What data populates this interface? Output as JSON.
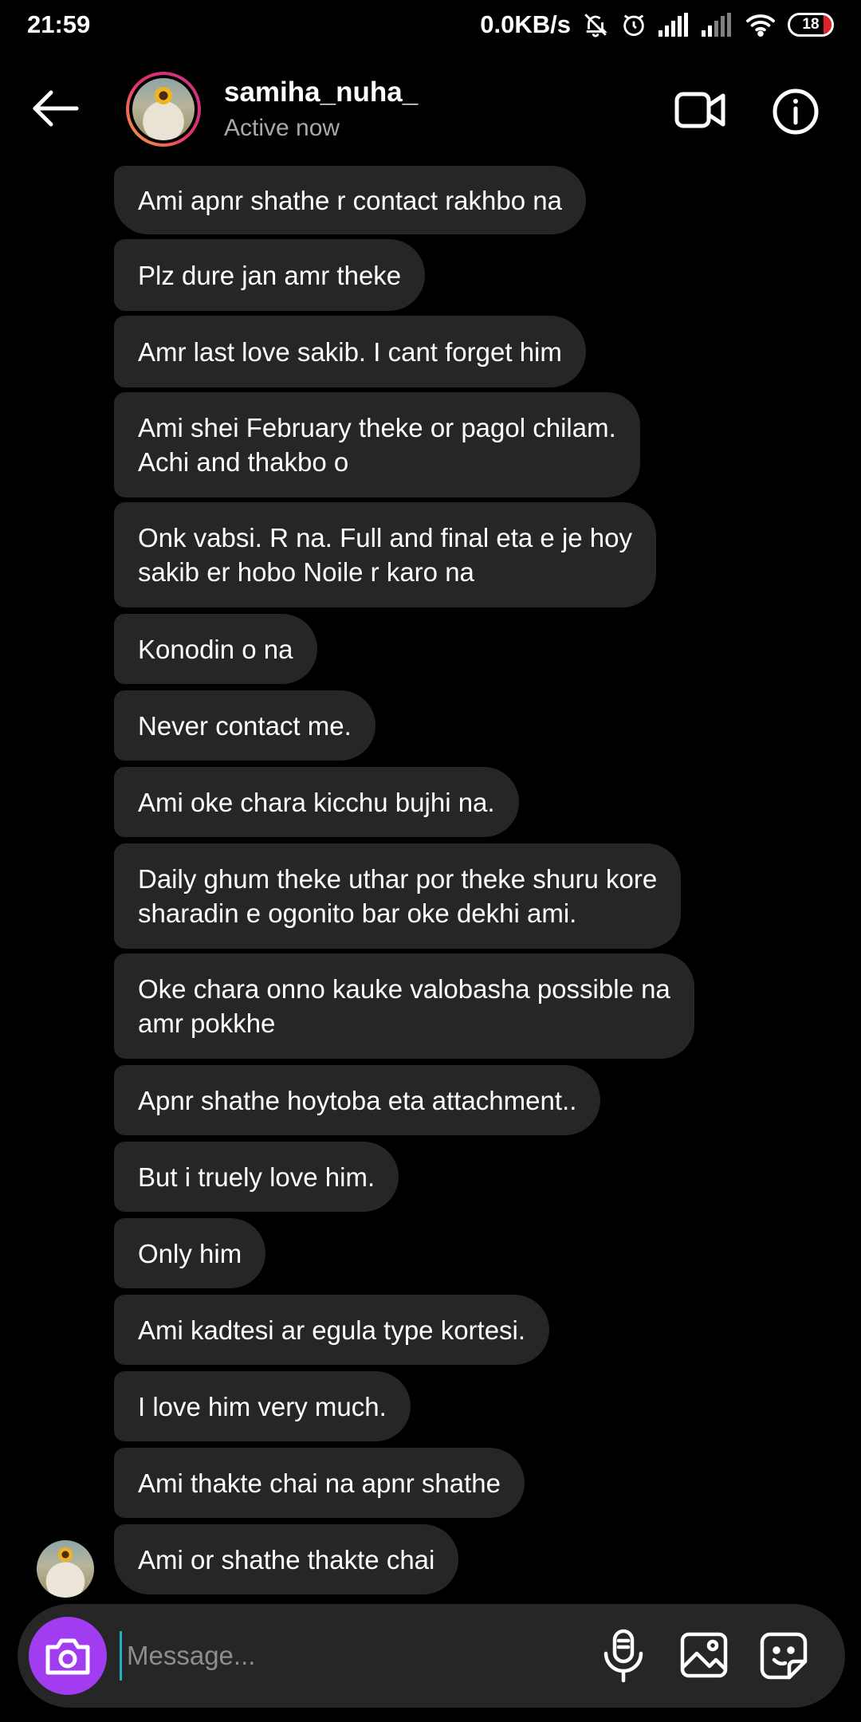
{
  "status_bar": {
    "time": "21:59",
    "network_speed": "0.0KB/s",
    "battery": "18"
  },
  "header": {
    "username": "samiha_nuha_",
    "status": "Active now"
  },
  "messages": [
    {
      "text": "Ami apnr shathe r contact rakhbo na"
    },
    {
      "text": "Plz dure jan amr theke"
    },
    {
      "text": "Amr last love sakib. I cant forget him"
    },
    {
      "text": "Ami shei February theke or pagol chilam.\nAchi and thakbo o"
    },
    {
      "text": "Onk vabsi. R na. Full and final eta e je hoy\nsakib er hobo Noile r karo na"
    },
    {
      "text": "Konodin o na"
    },
    {
      "text": "Never contact me."
    },
    {
      "text": "Ami oke chara kicchu bujhi na."
    },
    {
      "text": "Daily ghum theke uthar por theke shuru kore\nsharadin e ogonito bar oke dekhi ami."
    },
    {
      "text": "Oke chara onno kauke valobasha possible na\namr pokkhe"
    },
    {
      "text": "Apnr shathe hoytoba eta attachment.."
    },
    {
      "text": "But i truely love him."
    },
    {
      "text": "Only him"
    },
    {
      "text": "Ami kadtesi ar egula type kortesi."
    },
    {
      "text": "I love him very much."
    },
    {
      "text": "Ami thakte chai na apnr shathe"
    },
    {
      "text": "Ami or shathe thakte chai"
    }
  ],
  "composer": {
    "placeholder": "Message..."
  },
  "colors": {
    "background": "#000000",
    "bubble": "#262626",
    "camera_button": "#a13cf0",
    "online": "#4cd137",
    "battery_low": "#e0202a"
  }
}
